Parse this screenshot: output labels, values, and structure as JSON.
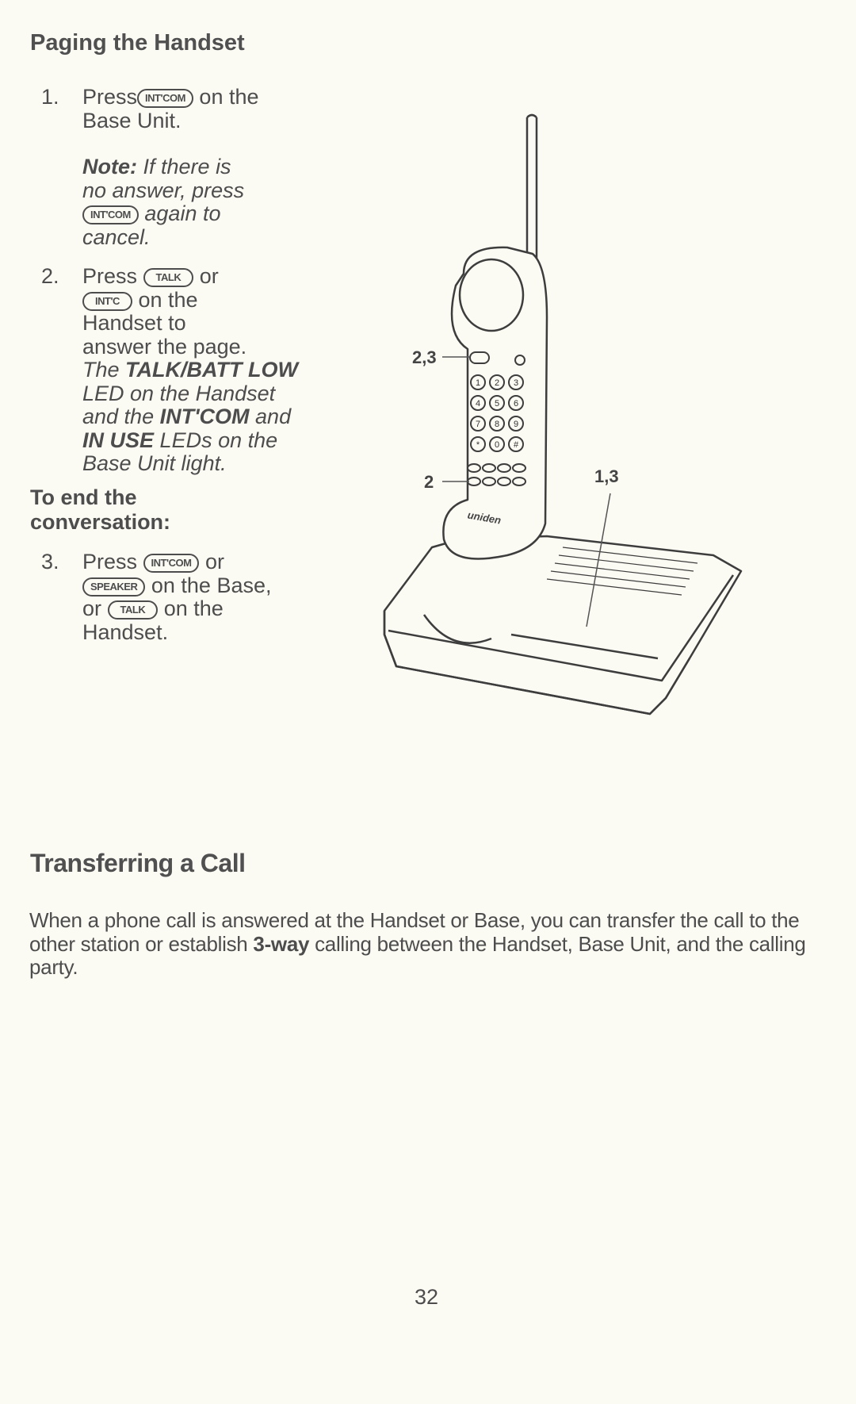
{
  "section1": {
    "title": "Paging the Handset",
    "step1": {
      "num": "1.",
      "pre": "Press",
      "key": "INT'COM",
      "post": "on the",
      "line2": "Base Unit.",
      "note_label": "Note:",
      "note_l1": "If there is",
      "note_l2": "no answer, press",
      "note_key": "INT'COM",
      "note_l3": "again to",
      "note_l4": "cancel."
    },
    "step2": {
      "num": "2.",
      "pre": "Press",
      "key1": "TALK",
      "or": "or",
      "key2": "INT'C",
      "post": "on the",
      "line3": "Handset to",
      "line4": "answer the page.",
      "i1": "The",
      "b1": "TALK/BATT LOW",
      "i2": "LED on the Handset",
      "i3": "and the",
      "b2": "INT'COM",
      "i4": "and",
      "b3": "IN USE",
      "i5": "LEDs on the",
      "i6": "Base Unit light."
    },
    "subheading_l1": "To end the",
    "subheading_l2": "conversation:",
    "step3": {
      "num": "3.",
      "pre": "Press",
      "key1": "INT'COM",
      "or": "or",
      "key2": "SPEAKER",
      "post2": "on the Base,",
      "or2": "or",
      "key3": "TALK",
      "post3": "on the",
      "line4": "Handset."
    }
  },
  "illustration": {
    "callout_23": "2,3",
    "callout_2": "2",
    "callout_13": "1,3",
    "brand": "uniden",
    "keypad": [
      "1",
      "2",
      "3",
      "4",
      "5",
      "6",
      "7",
      "8",
      "9",
      "*",
      "0",
      "#"
    ]
  },
  "section2": {
    "title": "Transferring a Call",
    "p_pre": "When a phone call is answered at the Handset or Base, you can transfer the call to the other station or establish ",
    "p_bold": "3-way",
    "p_post": " calling between the Handset, Base Unit, and the calling party."
  },
  "page_number": "32"
}
